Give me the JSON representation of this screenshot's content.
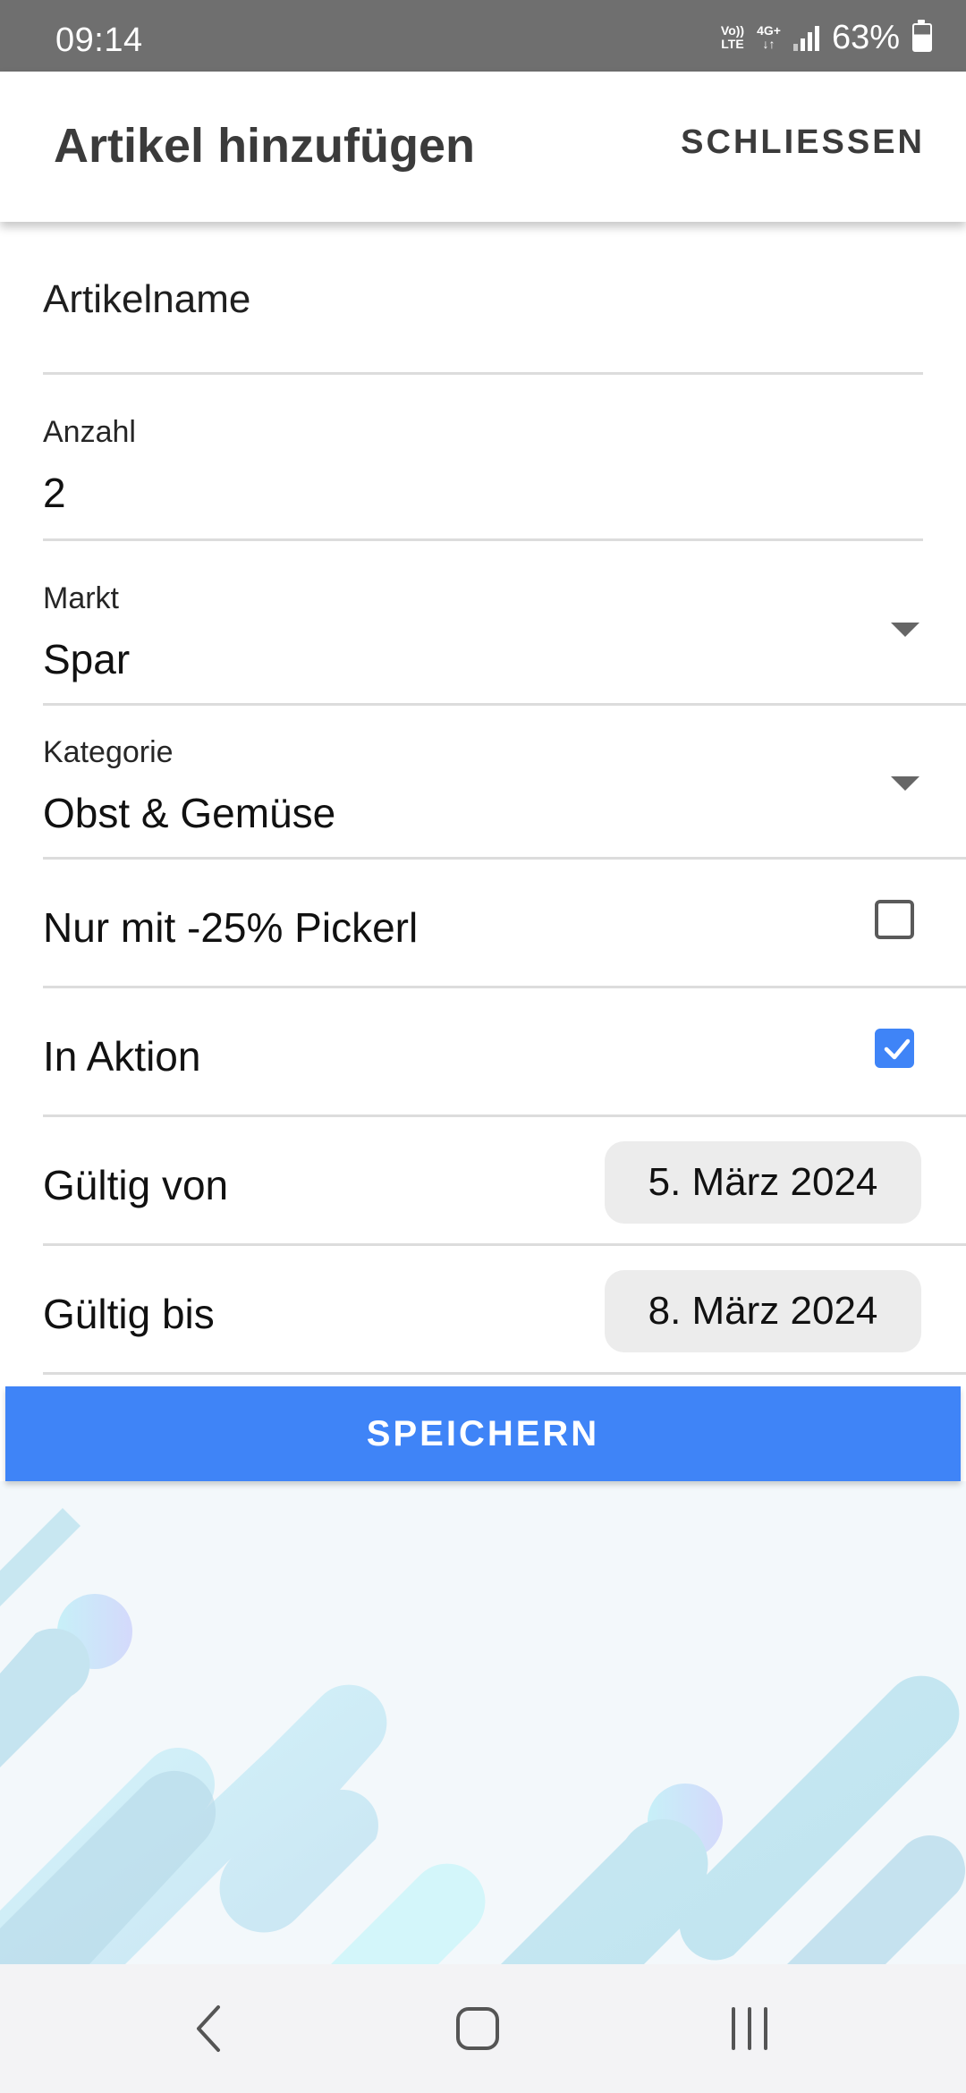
{
  "status_bar": {
    "time": "09:14",
    "volte_top": "Vo))",
    "volte_bottom": "LTE",
    "network_top": "4G+",
    "network_bottom": "↓↑",
    "battery": "63%",
    "battery_level": 0.63,
    "signal_icon": "signal-icon"
  },
  "app_bar": {
    "title": "Artikel hinzufügen",
    "close_label": "SCHLIESSEN"
  },
  "form": {
    "article_name_placeholder": "Artikelname",
    "quantity_label": "Anzahl",
    "quantity_value": "2",
    "market_label": "Markt",
    "market_value": "Spar",
    "category_label": "Kategorie",
    "category_value": "Obst & Gemüse",
    "sticker_label": "Nur mit -25% Pickerl",
    "sticker_checked": false,
    "promo_label": "In Aktion",
    "promo_checked": true,
    "valid_from_label": "Gültig von",
    "valid_from_value": "5. März 2024",
    "valid_to_label": "Gültig bis",
    "valid_to_value": "8. März 2024",
    "save_label": "SPEICHERN"
  },
  "colors": {
    "accent": "#3f84f7",
    "status_bar": "#6f6f6f",
    "chip": "#ececec"
  },
  "nav_bar": {
    "back_icon": "back-chevron-icon",
    "home_icon": "home-square-icon",
    "recents_icon": "recents-bars-icon"
  }
}
